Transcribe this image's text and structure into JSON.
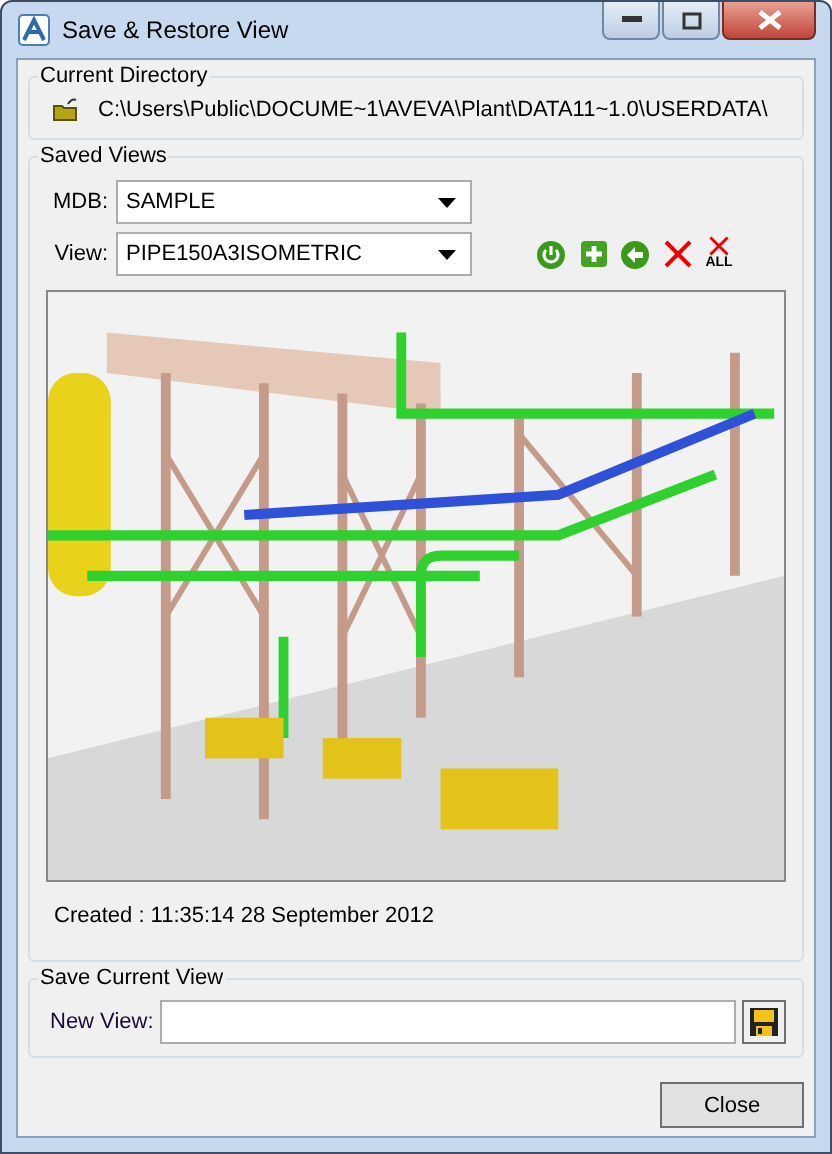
{
  "window": {
    "title": "Save & Restore View"
  },
  "current_directory": {
    "title": "Current Directory",
    "path": "C:\\Users\\Public\\DOCUME~1\\AVEVA\\Plant\\DATA11~1.0\\USERDATA\\"
  },
  "saved_views": {
    "title": "Saved Views",
    "mdb_label": "MDB:",
    "mdb_value": "SAMPLE",
    "view_label": "View:",
    "view_value": "PIPE150A3ISOMETRIC",
    "tools": [
      {
        "kind": "refresh"
      },
      {
        "kind": "add"
      },
      {
        "kind": "back"
      },
      {
        "kind": "delete"
      },
      {
        "kind": "delete_all",
        "label": "ALL"
      }
    ],
    "created": "Created : 11:35:14 28 September 2012"
  },
  "save_current_view": {
    "title": "Save Current View",
    "new_view_label": "New View:"
  },
  "buttons": [
    {
      "label": "Close"
    }
  ]
}
